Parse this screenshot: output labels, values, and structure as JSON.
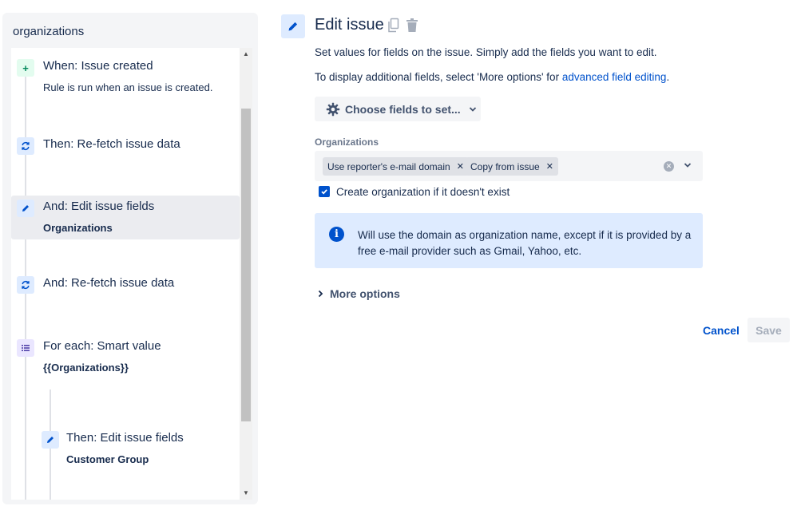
{
  "sidebar": {
    "title": "organizations",
    "steps": [
      {
        "icon": "plus-icon",
        "title": "When: Issue created",
        "subtitle": "Rule is run when an issue is created."
      },
      {
        "icon": "refresh-icon",
        "title": "Then: Re-fetch issue data",
        "subtitle": ""
      },
      {
        "icon": "pencil-icon",
        "title": "And: Edit issue fields",
        "subtitle": "Organizations"
      },
      {
        "icon": "refresh-icon",
        "title": "And: Re-fetch issue data",
        "subtitle": ""
      },
      {
        "icon": "list-icon",
        "title": "For each: Smart value",
        "subtitle": "{{Organizations}}"
      },
      {
        "icon": "pencil-icon",
        "title": "Then: Edit issue fields",
        "subtitle": "Customer Group"
      }
    ]
  },
  "editor": {
    "title": "Edit issue",
    "description": "Set values for fields on the issue. Simply add the fields you want to edit.",
    "additional_prefix": "To display additional fields, select 'More options' for ",
    "additional_link": "advanced field editing",
    "additional_suffix": ".",
    "choose_fields_label": "Choose fields to set...",
    "field": {
      "label": "Organizations",
      "tags": [
        "Use reporter's e-mail domain",
        "Copy from issue"
      ]
    },
    "checkbox": {
      "label": "Create organization if it doesn't exist",
      "checked": true
    },
    "info": "Will use the domain as organization name, except if it is provided by a free e-mail provider such as Gmail, Yahoo, etc.",
    "more_options": "More options",
    "cancel_label": "Cancel",
    "save_label": "Save"
  },
  "colors": {
    "accent": "#0052cc",
    "info_background": "#deebff",
    "trigger_icon": "#00875a",
    "branch_icon": "#5243aa"
  }
}
